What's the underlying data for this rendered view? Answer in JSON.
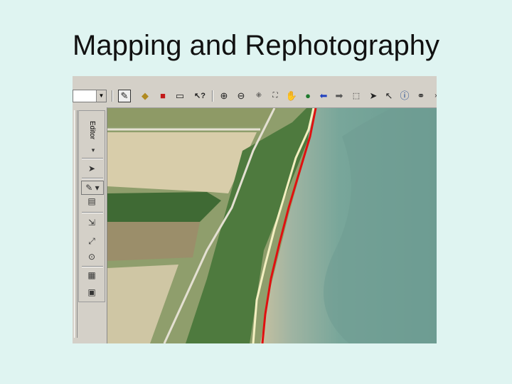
{
  "slide": {
    "title": "Mapping and Rephotography"
  },
  "toolbar": {
    "icons": [
      "editor-pencil-icon",
      "add-data-icon",
      "arctoolbox-icon",
      "window-icon",
      "whats-this-icon",
      "zoom-in-icon",
      "zoom-out-icon",
      "fixed-zoom-in-icon",
      "fixed-zoom-out-icon",
      "pan-hand-icon",
      "full-extent-globe-icon",
      "back-arrow-icon",
      "forward-arrow-icon",
      "select-features-icon",
      "select-elements-icon",
      "identify-icon",
      "find-binoculars-icon"
    ]
  },
  "editor": {
    "label": "Editor",
    "menu_arrow": "▾"
  },
  "map": {
    "line_colors": {
      "current_shoreline": "#e01010",
      "historic_shoreline": "#f3efc0"
    }
  }
}
